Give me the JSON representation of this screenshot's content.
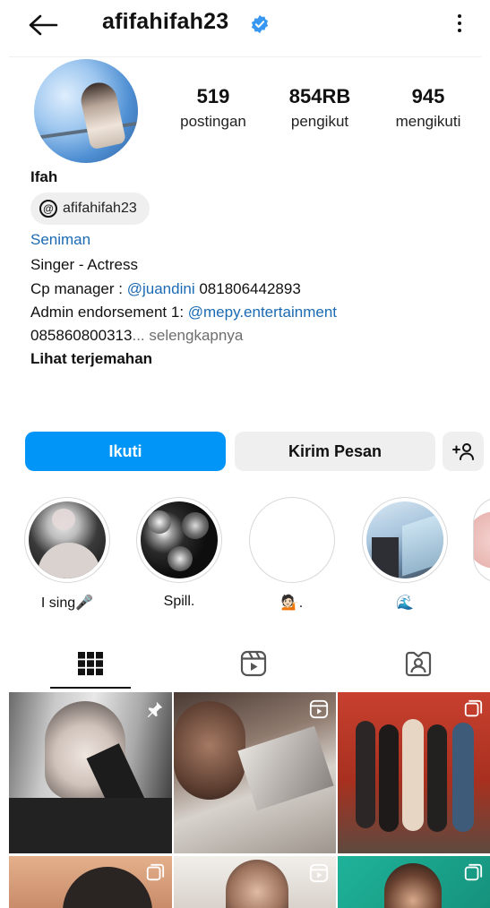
{
  "header": {
    "username": "afifahifah23"
  },
  "profile": {
    "stats": [
      {
        "value": "519",
        "label": "postingan"
      },
      {
        "value": "854RB",
        "label": "pengikut"
      },
      {
        "value": "945",
        "label": "mengikuti"
      }
    ],
    "name": "Ifah",
    "threads_handle": "afifahifah23",
    "category": "Seniman",
    "bio": {
      "line1": "Singer - Actress",
      "line2_prefix": "Cp manager : ",
      "line2_mention": "@juandini",
      "line2_suffix": " 081806442893",
      "line3_prefix": "Admin endorsement 1: ",
      "line3_mention": "@mepy.entertainment",
      "line4_text": "085860800313",
      "line4_more": "... selengkapnya",
      "translate": "Lihat terjemahan"
    }
  },
  "actions": {
    "follow": "Ikuti",
    "message": "Kirim Pesan",
    "add_user": "+°"
  },
  "highlights": [
    {
      "label": "I sing🎤"
    },
    {
      "label": "Spill."
    },
    {
      "label": "💁🏻."
    },
    {
      "label": "🌊"
    }
  ],
  "tabs": [
    "grid-icon",
    "reels-icon",
    "tagged-icon"
  ],
  "colors": {
    "accent": "#0095f6",
    "link": "#1b6ab3",
    "verified": "#3897f0"
  }
}
